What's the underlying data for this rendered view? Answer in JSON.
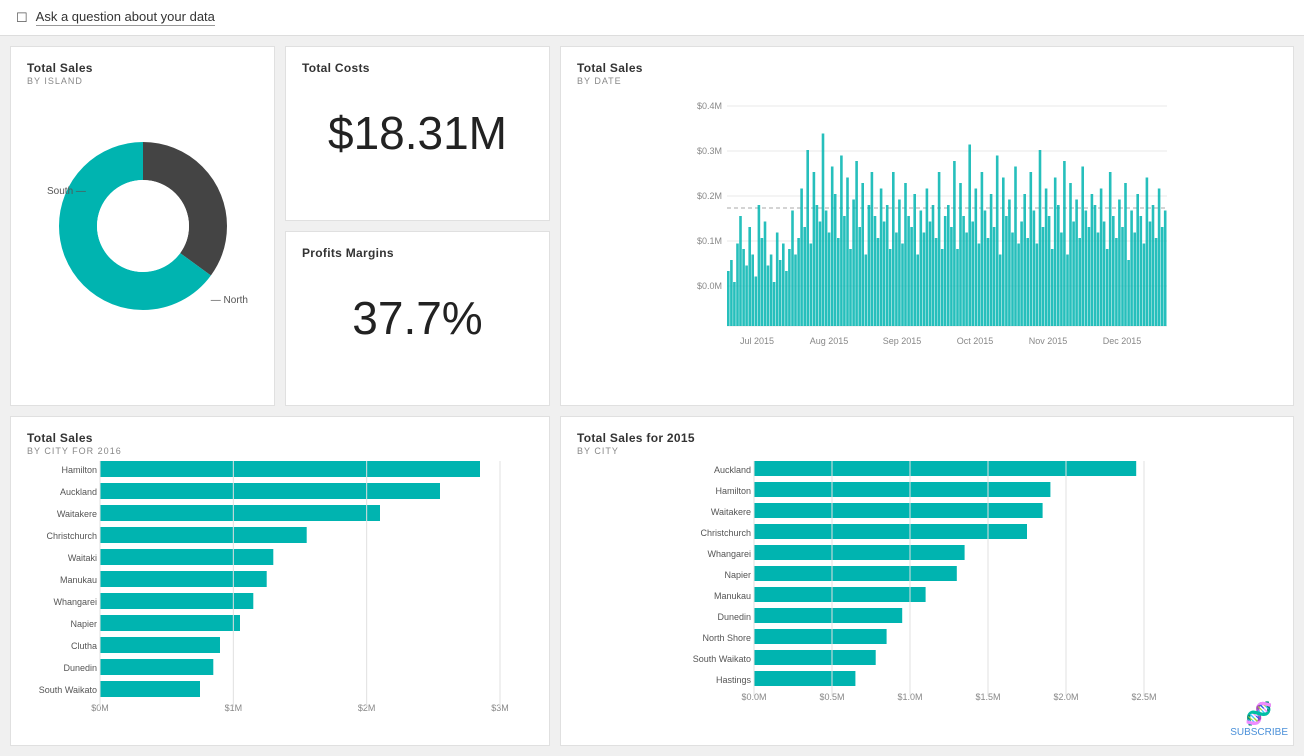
{
  "topbar": {
    "icon": "☐",
    "text": "Ask a question about your data"
  },
  "cards": {
    "totalSalesIsland": {
      "title": "Total Sales",
      "subtitle": "BY ISLAND",
      "labels": [
        "South",
        "North"
      ],
      "colors": [
        "#444",
        "#00b4b0"
      ],
      "values": [
        35,
        65
      ]
    },
    "totalCosts": {
      "title": "Total Costs",
      "value": "$18.31M"
    },
    "profitsMargins": {
      "title": "Profits Margins",
      "value": "37.7%"
    },
    "totalSalesDate": {
      "title": "Total Sales",
      "subtitle": "BY DATE",
      "yLabels": [
        "$0.4M",
        "$0.3M",
        "$0.2M",
        "$0.1M",
        "$0.0M"
      ],
      "xLabels": [
        "Jul 2015",
        "Aug 2015",
        "Sep 2015",
        "Oct 2015",
        "Nov 2015",
        "Dec 2015"
      ],
      "dashLineY": 0.17
    },
    "totalSalesCity2016": {
      "title": "Total Sales",
      "subtitle": "BY CITY FOR 2016",
      "xLabels": [
        "$0M",
        "$1M",
        "$2M",
        "$3M"
      ],
      "cities": [
        {
          "name": "Hamilton",
          "value": 2.85
        },
        {
          "name": "Auckland",
          "value": 2.55
        },
        {
          "name": "Waitakere",
          "value": 2.1
        },
        {
          "name": "Christchurch",
          "value": 1.55
        },
        {
          "name": "Waitaki",
          "value": 1.3
        },
        {
          "name": "Manukau",
          "value": 1.25
        },
        {
          "name": "Whangarei",
          "value": 1.15
        },
        {
          "name": "Napier",
          "value": 1.05
        },
        {
          "name": "Clutha",
          "value": 0.9
        },
        {
          "name": "Dunedin",
          "value": 0.85
        },
        {
          "name": "South Waikato",
          "value": 0.75
        }
      ],
      "maxValue": 3.0
    },
    "totalSalesCity2015": {
      "title": "Total Sales for 2015",
      "subtitle": "BY CITY",
      "xLabels": [
        "$0.0M",
        "$0.5M",
        "$1.0M",
        "$1.5M",
        "$2.0M",
        "$2.5M"
      ],
      "cities": [
        {
          "name": "Auckland",
          "value": 2.45
        },
        {
          "name": "Hamilton",
          "value": 1.9
        },
        {
          "name": "Waitakere",
          "value": 1.85
        },
        {
          "name": "Christchurch",
          "value": 1.75
        },
        {
          "name": "Whangarei",
          "value": 1.35
        },
        {
          "name": "Napier",
          "value": 1.3
        },
        {
          "name": "Manukau",
          "value": 1.1
        },
        {
          "name": "Dunedin",
          "value": 0.95
        },
        {
          "name": "North Shore",
          "value": 0.85
        },
        {
          "name": "South Waikato",
          "value": 0.78
        },
        {
          "name": "Hastings",
          "value": 0.65
        }
      ],
      "maxValue": 2.5
    }
  },
  "watermark": {
    "text": "SUBSCRIBE",
    "icon": "🧬"
  }
}
